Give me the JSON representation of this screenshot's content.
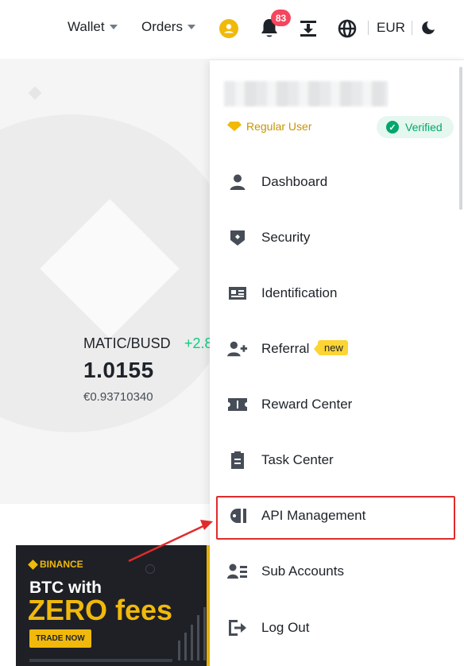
{
  "topbar": {
    "wallet_label": "Wallet",
    "orders_label": "Orders",
    "notification_count": "83",
    "currency": "EUR"
  },
  "market": {
    "pair": "MATIC/BUSD",
    "change": "+2.8",
    "price": "1.0155",
    "fiat_price": "€0.93710340"
  },
  "banner": {
    "brand": "BINANCE",
    "line1": "BTC with",
    "line2": "ZERO fees",
    "cta": "TRADE NOW"
  },
  "account": {
    "tier": "Regular User",
    "status": "Verified"
  },
  "menu": {
    "items": [
      {
        "label": "Dashboard",
        "icon": "user-icon"
      },
      {
        "label": "Security",
        "icon": "shield-icon"
      },
      {
        "label": "Identification",
        "icon": "id-card-icon"
      },
      {
        "label": "Referral",
        "icon": "user-plus-icon",
        "tag": "new"
      },
      {
        "label": "Reward Center",
        "icon": "ticket-icon"
      },
      {
        "label": "Task Center",
        "icon": "clipboard-icon"
      },
      {
        "label": "API Management",
        "icon": "api-icon"
      },
      {
        "label": "Sub Accounts",
        "icon": "users-list-icon"
      },
      {
        "label": "Log Out",
        "icon": "logout-icon"
      }
    ]
  },
  "colors": {
    "brand_yellow": "#f0b90b",
    "positive_green": "#0ecb81",
    "badge_red": "#f6465d",
    "highlight_red": "#e02b2b"
  }
}
